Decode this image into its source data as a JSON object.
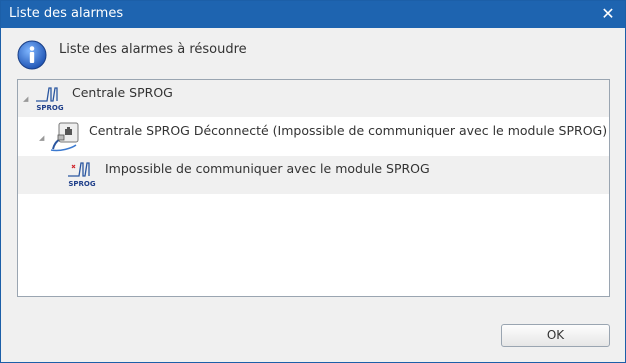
{
  "window": {
    "title": "Liste des alarmes"
  },
  "header": {
    "message": "Liste des alarmes à résoudre"
  },
  "tree": {
    "items": [
      {
        "label": "Centrale SPROG",
        "icon": "sprog-logo-icon",
        "icon_text": "SPROG",
        "expander": "◢"
      },
      {
        "label": "Centrale SPROG Déconnecté (Impossible de communiquer avec le module SPROG)",
        "icon": "disconnected-plug-icon",
        "expander": "◢"
      },
      {
        "label": "Impossible de communiquer avec le module SPROG",
        "icon": "sprog-error-icon",
        "icon_text": "SPROG"
      }
    ]
  },
  "footer": {
    "ok_label": "OK"
  }
}
